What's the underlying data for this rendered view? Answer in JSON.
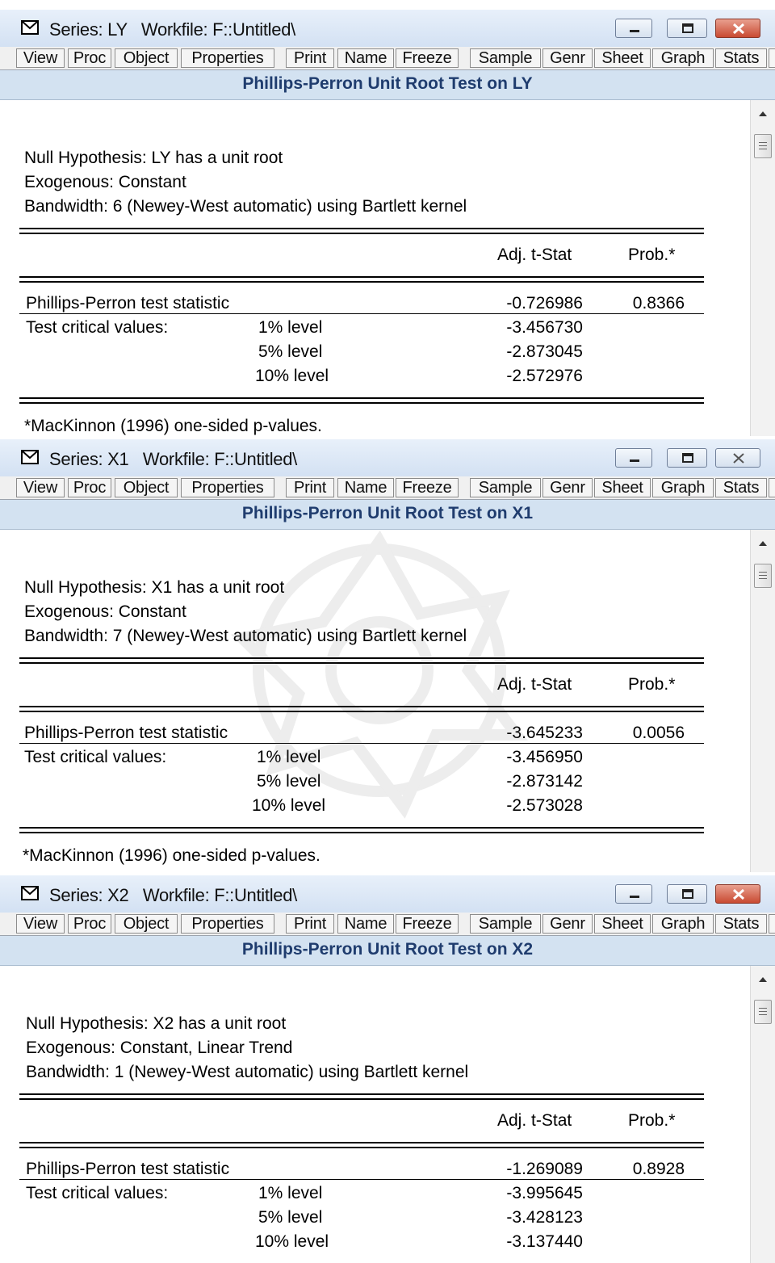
{
  "toolbar": [
    "View",
    "Proc",
    "Object",
    "Properties",
    "Print",
    "Name",
    "Freeze",
    "Sample",
    "Genr",
    "Sheet",
    "Graph",
    "Stats",
    "I"
  ],
  "col_headers": {
    "adj": "Adj. t-Stat",
    "prob": "Prob.*"
  },
  "labels": {
    "pp_stat": "Phillips-Perron test statistic",
    "crit": "Test critical values:",
    "lvl1": "1% level",
    "lvl5": "5% level",
    "lvl10": "10% level",
    "footnote": "*MacKinnon (1996) one-sided p-values."
  },
  "windows": [
    {
      "title": "Series: LY   Workfile: F::Untitled\\",
      "header": "Phillips-Perron Unit Root Test on LY",
      "null_hyp": "Null Hypothesis: LY has a unit root",
      "exogenous": "Exogenous: Constant",
      "bandwidth": "Bandwidth: 6 (Newey-West automatic) using Bartlett kernel",
      "pp_stat": "-0.726986",
      "pp_prob": "0.8366",
      "cv1": "-3.456730",
      "cv5": "-2.873045",
      "cv10": "-2.572976",
      "close_active": true
    },
    {
      "title": "Series: X1   Workfile: F::Untitled\\",
      "header": "Phillips-Perron Unit Root Test on X1",
      "null_hyp": "Null Hypothesis: X1 has a unit root",
      "exogenous": "Exogenous: Constant",
      "bandwidth": "Bandwidth: 7 (Newey-West automatic) using Bartlett kernel",
      "pp_stat": "-3.645233",
      "pp_prob": "0.0056",
      "cv1": "-3.456950",
      "cv5": "-2.873142",
      "cv10": "-2.573028",
      "close_active": false
    },
    {
      "title": "Series: X2   Workfile: F::Untitled\\",
      "header": "Phillips-Perron Unit Root Test on X2",
      "null_hyp": "Null Hypothesis: X2 has a unit root",
      "exogenous": "Exogenous: Constant, Linear Trend",
      "bandwidth": "Bandwidth: 1 (Newey-West automatic) using Bartlett kernel",
      "pp_stat": "-1.269089",
      "pp_prob": "0.8928",
      "cv1": "-3.995645",
      "cv5": "-3.428123",
      "cv10": "-3.137440",
      "close_active": true
    }
  ],
  "colors": {
    "header_bg": "#d3e2f1",
    "header_text": "#1f3c6e",
    "close_red": "#c94a32"
  }
}
